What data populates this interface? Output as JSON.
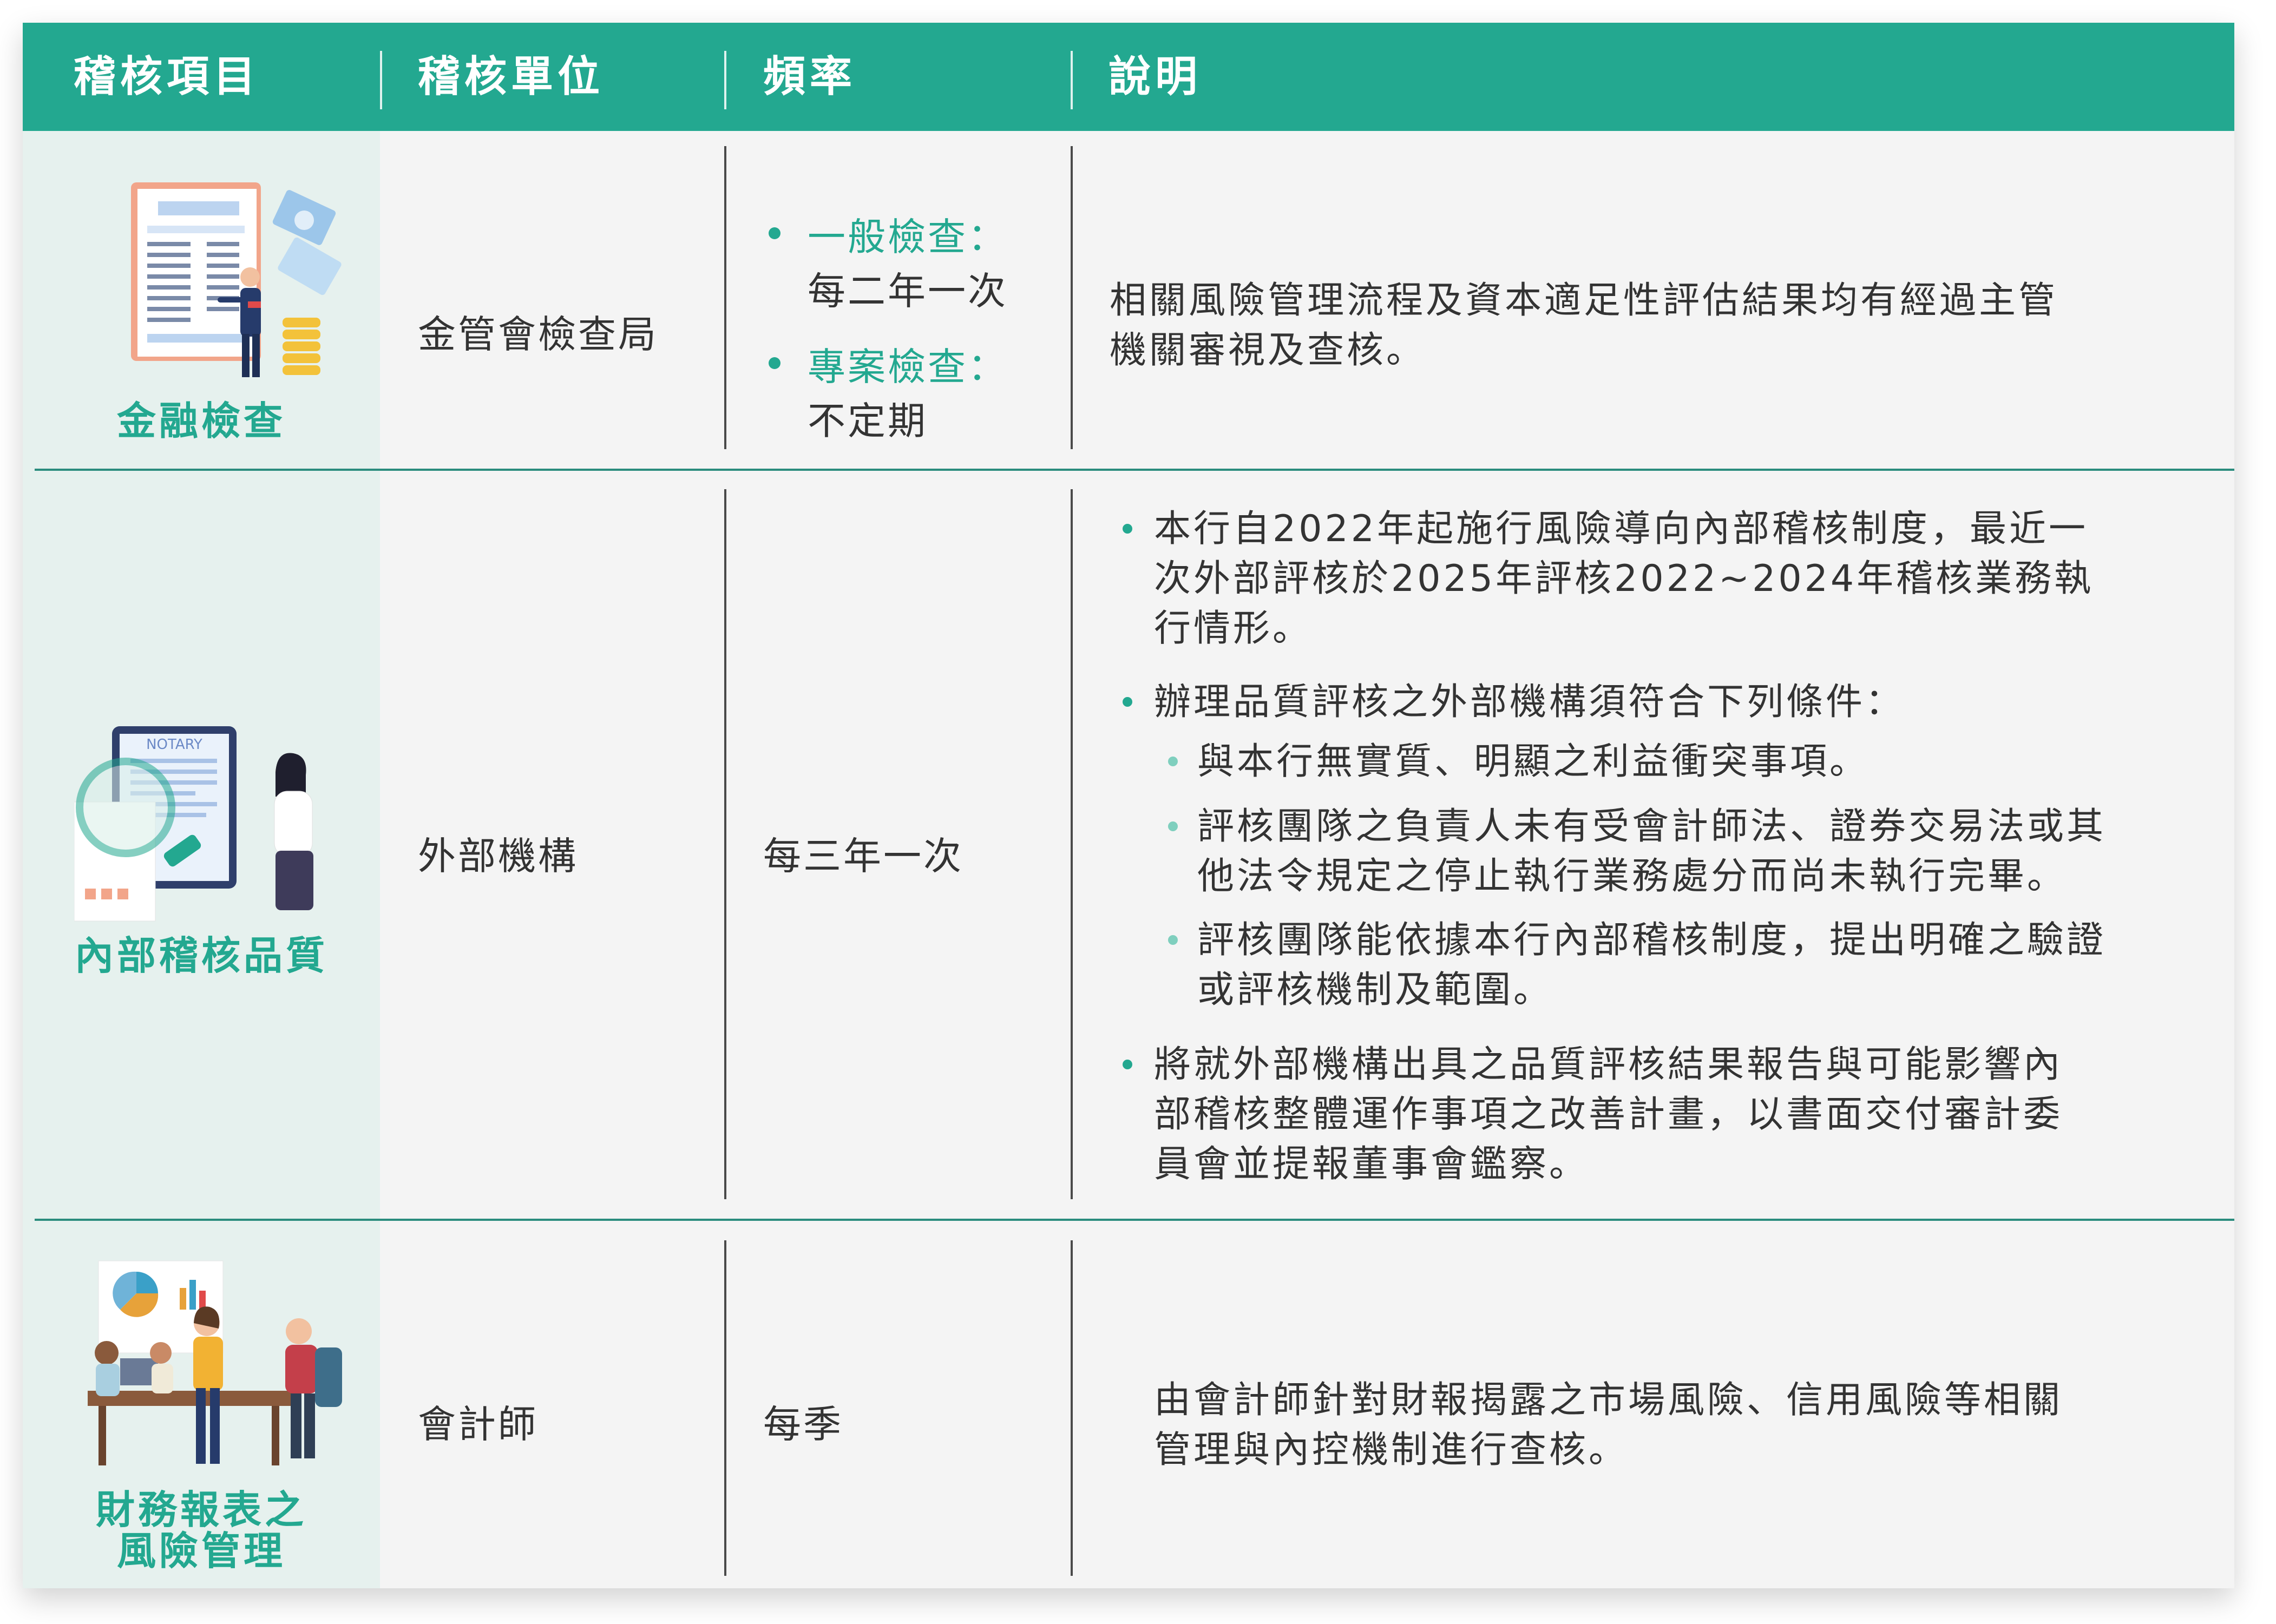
{
  "header": {
    "col_item": "稽核項目",
    "col_unit": "稽核單位",
    "col_freq": "頻率",
    "col_desc": "說明"
  },
  "rows": [
    {
      "item": "金融檢查",
      "unit": "金管會檢查局",
      "freq": [
        {
          "head": "一般檢查：",
          "value": "每二年一次"
        },
        {
          "head": "專案檢查：",
          "value": "不定期"
        }
      ],
      "desc_lines": [
        "相關風險管理流程及資本適足性評估結果均有經過主管",
        "機關審視及查核。"
      ],
      "illustration": "financial-document-icon"
    },
    {
      "item": "內部稽核品質",
      "unit": "外部機構",
      "freq_text": "每三年一次",
      "bullets": [
        {
          "lines": [
            "本行自2022年起施行風險導向內部稽核制度，最近一",
            "次外部評核於2025年評核2022~2024年稽核業務執",
            "行情形。"
          ]
        },
        {
          "lines": [
            "辦理品質評核之外部機構須符合下列條件："
          ]
        },
        {
          "lines": [
            "將就外部機構出具之品質評核結果報告與可能影響內",
            "部稽核整體運作事項之改善計畫，以書面交付審計委",
            "員會並提報董事會鑑察。"
          ]
        }
      ],
      "subbullets": [
        {
          "lines": [
            "與本行無實質、明顯之利益衝突事項。"
          ]
        },
        {
          "lines": [
            "評核團隊之負責人未有受會計師法、證券交易法或其",
            "他法令規定之停止執行業務處分而尚未執行完畢。"
          ]
        },
        {
          "lines": [
            "評核團隊能依據本行內部稽核制度，提出明確之驗證",
            "或評核機制及範圍。"
          ]
        }
      ],
      "illustration": "notary-magnifier-icon"
    },
    {
      "item_lines": [
        "財務報表之",
        "風險管理"
      ],
      "unit": "會計師",
      "freq_text": "每季",
      "desc_lines": [
        "由會計師針對財報揭露之市場風險、信用風險等相關",
        "管理與內控機制進行查核。"
      ],
      "illustration": "meeting-team-icon"
    }
  ],
  "illustration_texts": {
    "notary": "NOTARY"
  },
  "colors": {
    "accent": "#23a890",
    "accent_light": "#7fcfbe",
    "left_column_bg": "#e6f1ee",
    "card_bg": "#f4f4f4",
    "text": "#333333"
  }
}
